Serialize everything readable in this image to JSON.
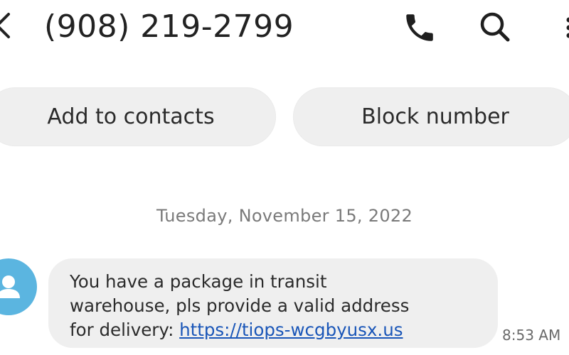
{
  "header": {
    "back_icon": "chevron-left-icon",
    "title": "(908) 219-2799",
    "call_icon": "phone-icon",
    "search_icon": "search-icon",
    "more_icon": "more-vertical-icon"
  },
  "actions": {
    "add_to_contacts": "Add to contacts",
    "block_number": "Block number"
  },
  "conversation": {
    "date": "Tuesday, November 15, 2022",
    "messages": [
      {
        "avatar_icon": "person-icon",
        "line1": "You have a package in transit",
        "line2": "warehouse, pls provide a valid address",
        "line3_prefix": "for delivery: ",
        "link": "https://tiops-wcgbyusx.us",
        "time": "8:53 AM"
      }
    ]
  },
  "colors": {
    "avatar": "#5bb5e0",
    "pill_bg": "#efefef",
    "bubble_bg": "#efefef",
    "link": "#1a56b8"
  }
}
